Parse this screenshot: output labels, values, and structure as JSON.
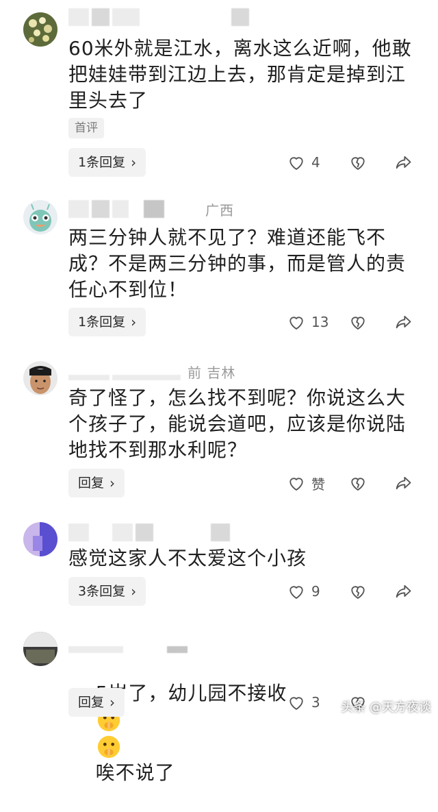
{
  "comments": [
    {
      "meta_text": "",
      "body": "60米外就是江水，离水这么近啊，他敢把娃娃带到江边上去，那肯定是掉到江里头去了",
      "tag": "首评",
      "reply_label": "1条回复",
      "likes": "4"
    },
    {
      "meta_text": "广西",
      "body": "两三分钟人就不见了？难道还能飞不成？不是两三分钟的事，而是管人的责任心不到位！",
      "reply_label": "1条回复",
      "likes": "13"
    },
    {
      "meta_text": "前  吉林",
      "body": "奇了怪了，怎么找不到呢？你说这么大个孩子了，能说会道吧，应该是你说陆地找不到那水利呢？",
      "reply_label": "回复",
      "likes": "赞"
    },
    {
      "meta_text": "",
      "body": "感觉这家人不太爱这个小孩",
      "reply_label": "3条回复",
      "likes": "9"
    },
    {
      "meta_text": "",
      "body_before": "5岁了，幼儿园不接收",
      "body_after": "唉不说了",
      "reply_label": "回复",
      "likes": "3"
    }
  ],
  "icons": {
    "like": "heart-outline-icon",
    "dislike": "broken-heart-icon",
    "share": "share-arrow-icon",
    "chevron": "chevron-right-icon",
    "emoji": "shushing-face-emoji"
  },
  "watermark": "头条 @天方夜谈",
  "colors": {
    "text": "#1f1f1f",
    "muted": "#9a9a9a",
    "button_bg": "#f2f2f2"
  }
}
